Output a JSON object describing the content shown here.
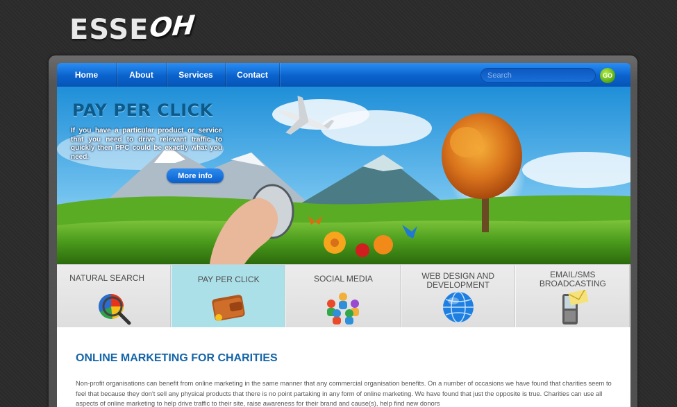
{
  "logo": {
    "part1": "ESSE",
    "part2": "OH"
  },
  "nav": {
    "items": [
      "Home",
      "About",
      "Services",
      "Contact"
    ],
    "search_placeholder": "Search",
    "go_label": "GO"
  },
  "hero": {
    "title": "PAY PER CLICK",
    "text": "If you have a particular product or service that you need to drive relevant traffic to quickly then PPC could be exactly what you need.",
    "button": "More info"
  },
  "services": [
    {
      "label": "NATURAL SEARCH",
      "icon": "pie-chart-magnifier-icon"
    },
    {
      "label": "PAY PER CLICK",
      "icon": "wallet-icon"
    },
    {
      "label": "SOCIAL MEDIA",
      "icon": "people-group-icon"
    },
    {
      "label": "WEB DESIGN AND DEVELOPMENT",
      "icon": "globe-icon"
    },
    {
      "label": "EMAIL/SMS BROADCASTING",
      "icon": "phone-email-icon"
    }
  ],
  "active_service_index": 1,
  "content": {
    "title": "ONLINE MARKETING FOR CHARITIES",
    "body": "Non-profit organisations can benefit from online marketing in the same manner that any commercial organisation benefits. On a number of occasions we have found that charities seem to feel that because they don't sell any physical products that there is no point partaking in any form of online marketing. We have found that just the opposite is true. Charities can use all aspects of online marketing to help drive traffic to their site, raise awareness for their brand and cause(s), help find new donors"
  },
  "colors": {
    "background": "#2b2b2b",
    "nav_blue": "#0a62cc",
    "active_tab": "#abe0e8",
    "heading_blue": "#1565a8",
    "go_green": "#52a60e"
  }
}
